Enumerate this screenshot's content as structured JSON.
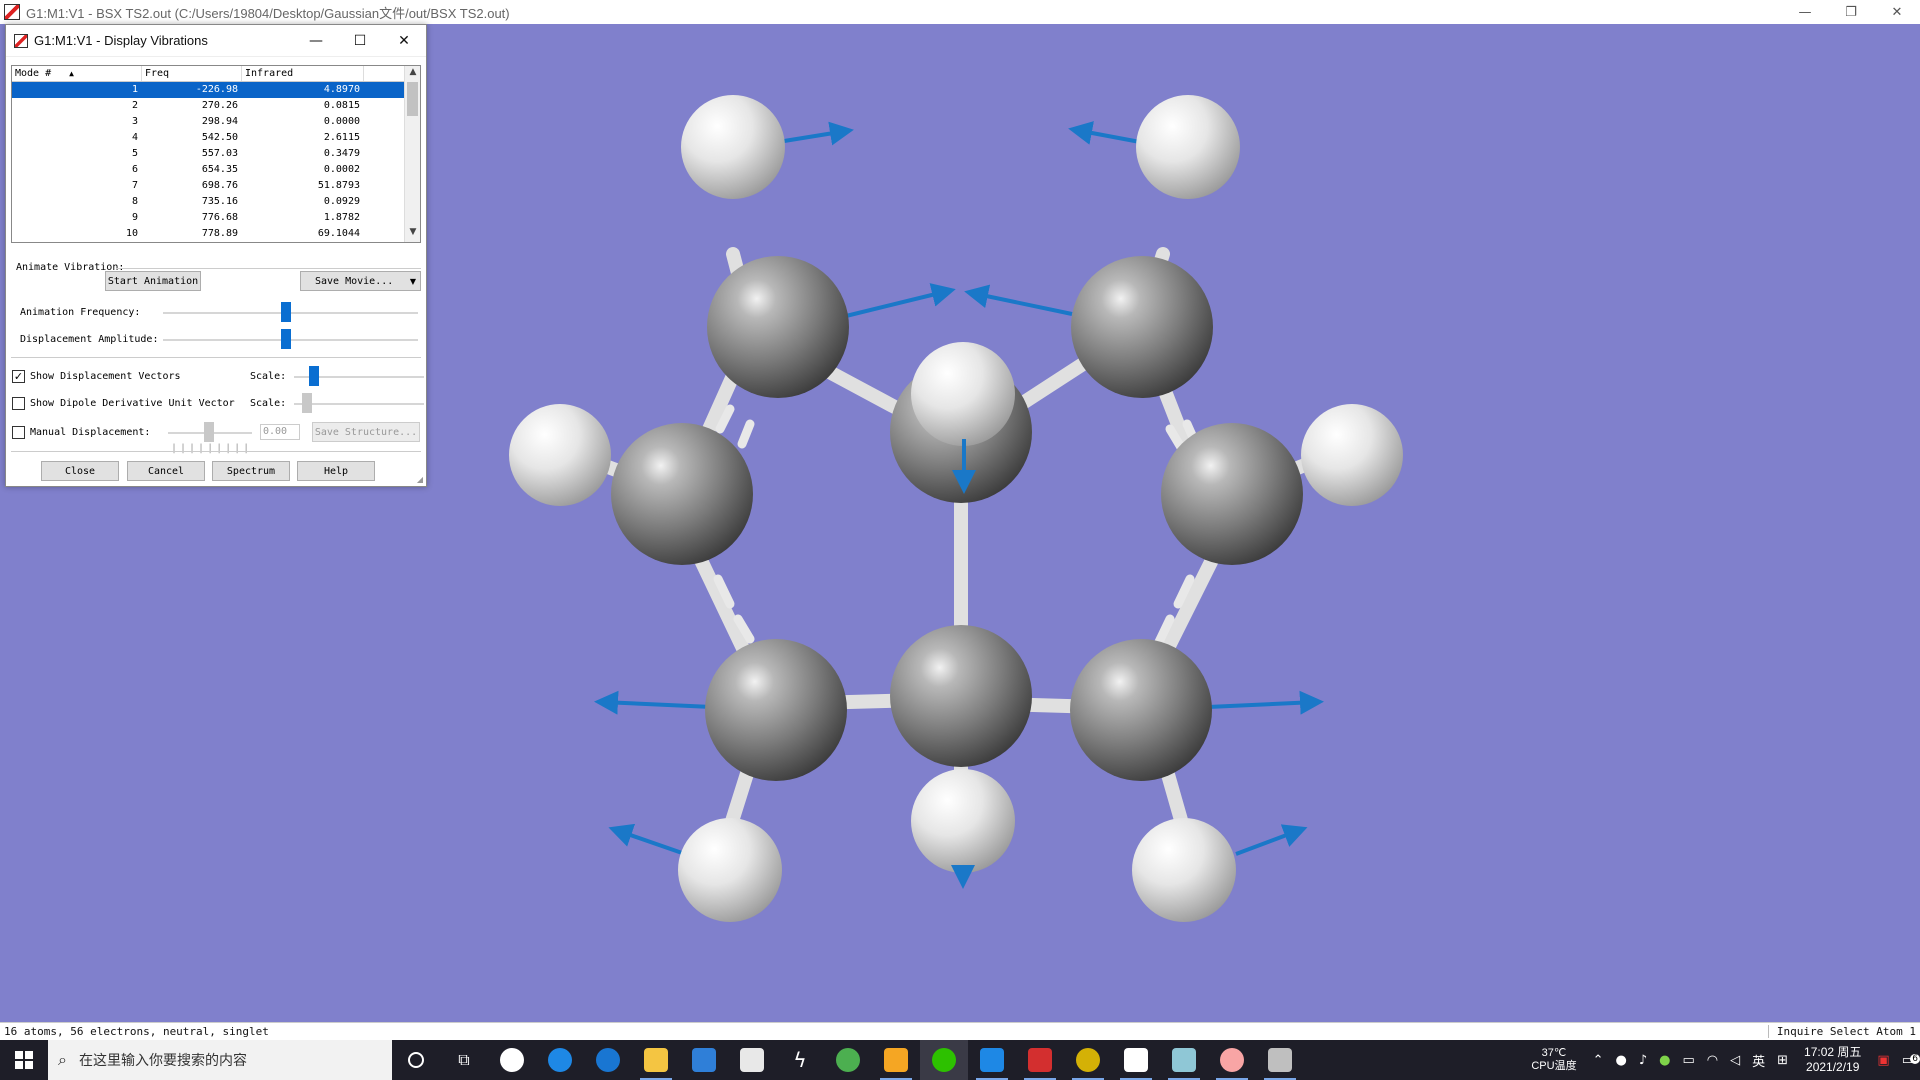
{
  "main_window": {
    "title": "G1:M1:V1 - BSX TS2.out (C:/Users/19804/Desktop/Gaussian文件/out/BSX TS2.out)",
    "controls": {
      "minimize": "—",
      "restore": "❐",
      "close": "✕"
    },
    "background_color": "#8080cc"
  },
  "dialog": {
    "title": "G1:M1:V1 - Display Vibrations",
    "controls": {
      "minimize": "—",
      "maximize": "☐",
      "close": "✕"
    },
    "table": {
      "headers": {
        "mode": "Mode #",
        "freq": "Freq",
        "infrared": "Infrared"
      },
      "sort_indicator": "▲",
      "rows": [
        {
          "mode": "1",
          "freq": "-226.98",
          "infrared": "4.8970"
        },
        {
          "mode": "2",
          "freq": "270.26",
          "infrared": "0.0815"
        },
        {
          "mode": "3",
          "freq": "298.94",
          "infrared": "0.0000"
        },
        {
          "mode": "4",
          "freq": "542.50",
          "infrared": "2.6115"
        },
        {
          "mode": "5",
          "freq": "557.03",
          "infrared": "0.3479"
        },
        {
          "mode": "6",
          "freq": "654.35",
          "infrared": "0.0002"
        },
        {
          "mode": "7",
          "freq": "698.76",
          "infrared": "51.8793"
        },
        {
          "mode": "8",
          "freq": "735.16",
          "infrared": "0.0929"
        },
        {
          "mode": "9",
          "freq": "776.68",
          "infrared": "1.8782"
        },
        {
          "mode": "10",
          "freq": "778.89",
          "infrared": "69.1044"
        }
      ],
      "selected_row": 0
    },
    "animate_label": "Animate Vibration:",
    "start_animation": "Start Animation",
    "save_movie": "Save Movie...",
    "animation_frequency_label": "Animation Frequency:",
    "displacement_amplitude_label": "Displacement Amplitude:",
    "animation_frequency_level": 0.5,
    "displacement_amplitude_level": 0.5,
    "show_displacement_vectors": {
      "label": "Show Displacement Vectors",
      "checked": true,
      "mark": "✓"
    },
    "show_dipole": {
      "label": "Show Dipole Derivative Unit Vector",
      "checked": false
    },
    "manual_displacement": {
      "label": "Manual Displacement:",
      "checked": false,
      "value": "0.00"
    },
    "scale_label": "Scale:",
    "save_structure": "Save Structure...",
    "buttons": {
      "close": "Close",
      "cancel": "Cancel",
      "spectrum": "Spectrum",
      "help": "Help"
    }
  },
  "status_bar": {
    "left": "16 atoms, 56 electrons, neutral, singlet",
    "right": "Inquire Select Atom 1"
  },
  "taskbar": {
    "search_placeholder": "在这里输入你要搜索的内容",
    "temperature": "37℃",
    "cpu_label": "CPU温度",
    "ime": "英",
    "time": "17:02 周五",
    "date": "2021/2/19",
    "badge_count": "6"
  }
}
